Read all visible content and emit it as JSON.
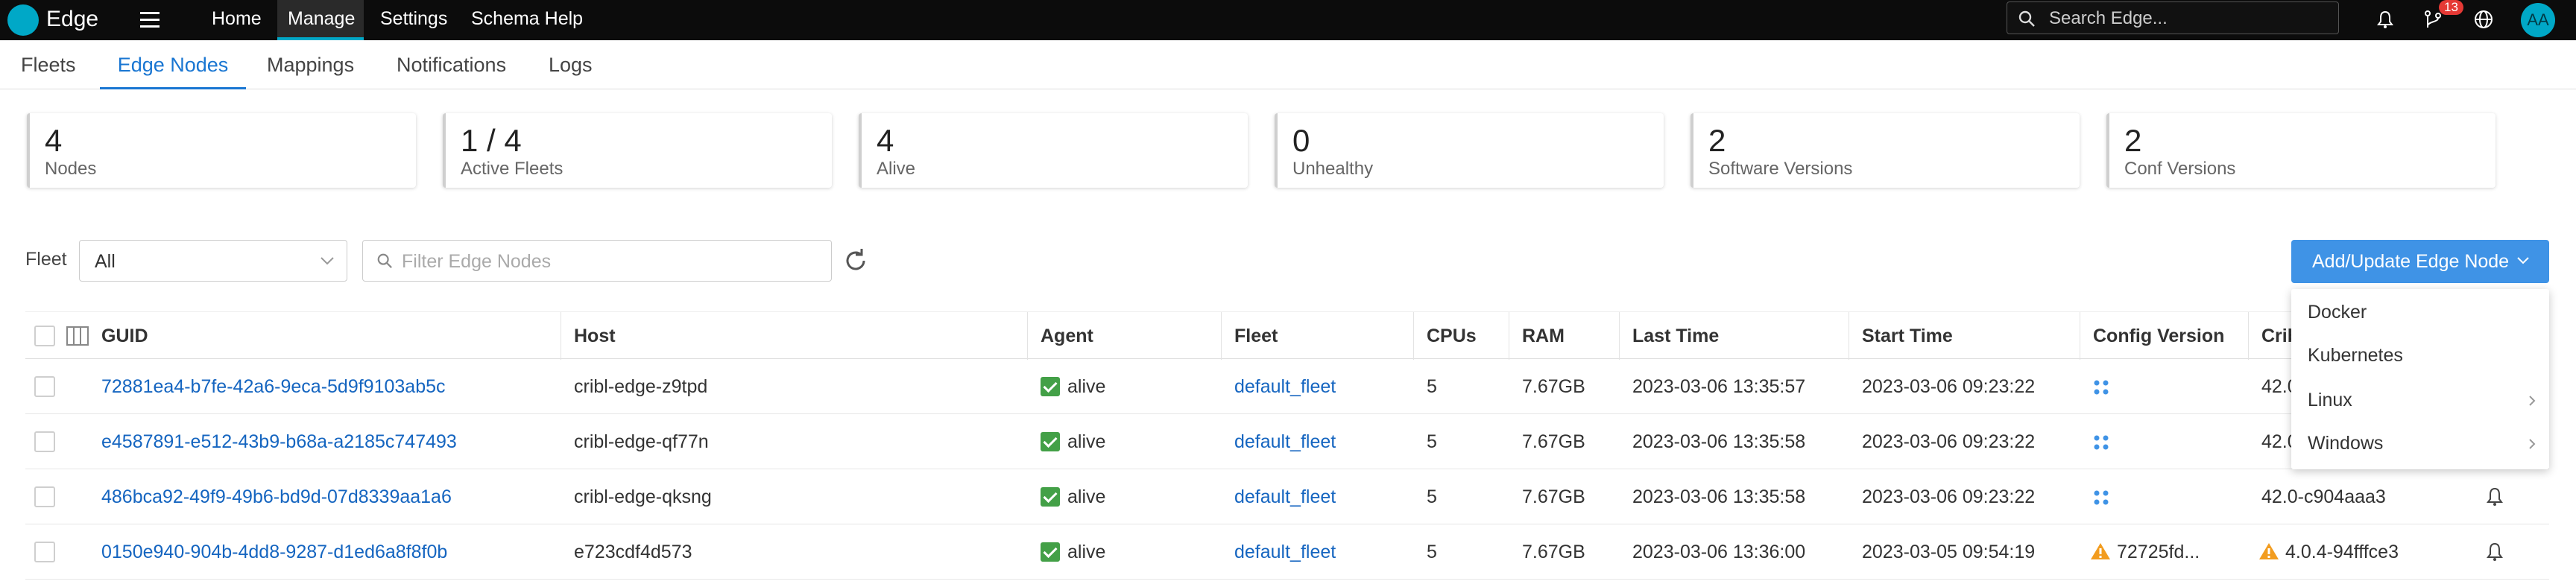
{
  "app": {
    "name": "Edge"
  },
  "topnav": {
    "items": [
      "Home",
      "Manage",
      "Settings",
      "Schema Help"
    ],
    "active": "Manage"
  },
  "search": {
    "placeholder": "Search Edge..."
  },
  "notifications": {
    "badge": "13"
  },
  "user": {
    "initials": "AA"
  },
  "tabs": {
    "items": [
      "Fleets",
      "Edge Nodes",
      "Mappings",
      "Notifications",
      "Logs"
    ],
    "active": "Edge Nodes"
  },
  "stats": [
    {
      "value": "4",
      "label": "Nodes"
    },
    {
      "value": "1 / 4",
      "label": "Active Fleets"
    },
    {
      "value": "4",
      "label": "Alive"
    },
    {
      "value": "0",
      "label": "Unhealthy"
    },
    {
      "value": "2",
      "label": "Software Versions"
    },
    {
      "value": "2",
      "label": "Conf Versions"
    }
  ],
  "filters": {
    "fleet_label": "Fleet",
    "fleet_value": "All",
    "filter_placeholder": "Filter Edge Nodes"
  },
  "add_button": {
    "label": "Add/Update Edge Node"
  },
  "add_menu": {
    "items": [
      "Docker",
      "Kubernetes",
      "Linux",
      "Windows"
    ]
  },
  "table": {
    "columns": [
      "GUID",
      "Host",
      "Agent",
      "Fleet",
      "CPUs",
      "RAM",
      "Last Time",
      "Start Time",
      "Config Version",
      "Crib"
    ],
    "rows": [
      {
        "guid": "72881ea4-b7fe-42a6-9eca-5d9f9103ab5c",
        "host": "cribl-edge-z9tpd",
        "agent": "alive",
        "fleet": "default_fleet",
        "cpus": "5",
        "ram": "7.67GB",
        "last_time": "2023-03-06 13:35:57",
        "start_time": "2023-03-06 09:23:22",
        "config_version": "",
        "cribl_version": "42.0"
      },
      {
        "guid": "e4587891-e512-43b9-b68a-a2185c747493",
        "host": "cribl-edge-qf77n",
        "agent": "alive",
        "fleet": "default_fleet",
        "cpus": "5",
        "ram": "7.67GB",
        "last_time": "2023-03-06 13:35:58",
        "start_time": "2023-03-06 09:23:22",
        "config_version": "",
        "cribl_version": "42.0"
      },
      {
        "guid": "486bca92-49f9-49b6-bd9d-07d8339aa1a6",
        "host": "cribl-edge-qksng",
        "agent": "alive",
        "fleet": "default_fleet",
        "cpus": "5",
        "ram": "7.67GB",
        "last_time": "2023-03-06 13:35:58",
        "start_time": "2023-03-06 09:23:22",
        "config_version": "",
        "cribl_version": "42.0-c904aaa3"
      },
      {
        "guid": "0150e940-904b-4dd8-9287-d1ed6a8f8f0b",
        "host": "e723cdf4d573",
        "agent": "alive",
        "fleet": "default_fleet",
        "cpus": "5",
        "ram": "7.67GB",
        "last_time": "2023-03-06 13:36:00",
        "start_time": "2023-03-05 09:54:19",
        "config_version": "72725fd...",
        "cribl_version": "4.0.4-94fffce3"
      }
    ]
  },
  "colors": {
    "accent": "#1976d2",
    "button": "#3f93e6",
    "alive": "#43a047",
    "warning": "#f29c1f",
    "brand": "#00a8c7"
  }
}
